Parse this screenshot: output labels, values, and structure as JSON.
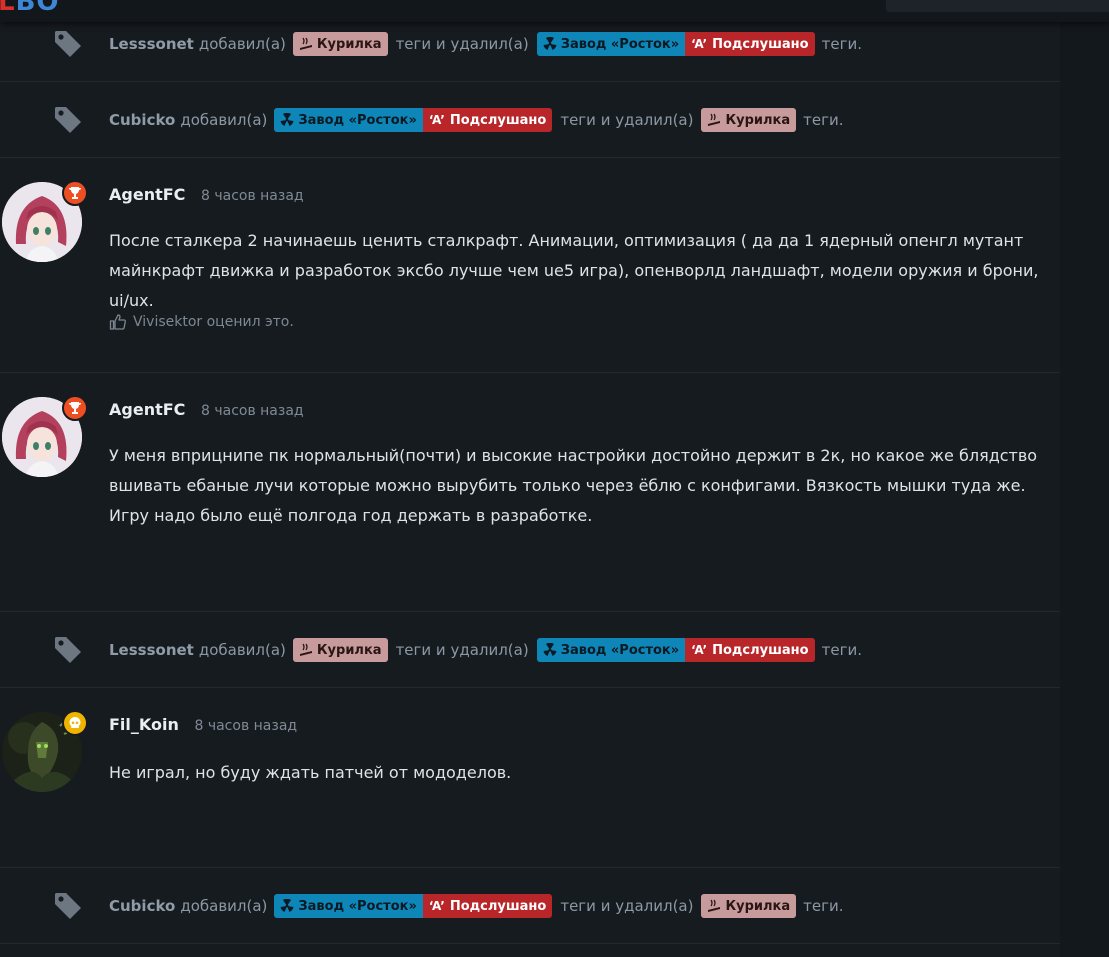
{
  "header": {
    "logo_part1": "L",
    "logo_part2": "BO"
  },
  "tags": {
    "smoke": "Курилка",
    "plant": "Завод «Росток»",
    "heard_mark": "‘A’",
    "heard": "Подслушано"
  },
  "events": [
    {
      "user": "Lesssonet",
      "added": "добавил(а)",
      "middle": "теги и удалил(а)",
      "tail": "теги."
    },
    {
      "user": "Cubicko",
      "added": "добавил(а)",
      "middle": "теги и удалил(а)",
      "tail": "теги."
    },
    {
      "user": "Lesssonet",
      "added": "добавил(а)",
      "middle": "теги и удалил(а)",
      "tail": "теги."
    },
    {
      "user": "Cubicko",
      "added": "добавил(а)",
      "middle": "теги и удалил(а)",
      "tail": "теги."
    }
  ],
  "posts": [
    {
      "author": "AgentFC",
      "time": "8 часов назад",
      "text": "После сталкера 2 начинаешь ценить сталкрафт. Анимации, оптимизация ( да да 1 ядерный опенгл мутант майнкрафт движка и разработок эксбо лучше чем ue5 игра), опенворлд ландшафт, модели оружия и брони, ui/ux.",
      "likes": "Vivisektor оценил это.",
      "badge_icon": "trophy-icon"
    },
    {
      "author": "AgentFC",
      "time": "8 часов назад",
      "text": "У меня вприцнипе пк нормальный(почти) и высокие настройки достойно держит в 2к, но какое же блядство вшивать ебаные лучи которые можно вырубить только через ёблю с конфигами. Вязкость мышки туда же. Игру надо было ещё полгода год держать в разработке.",
      "badge_icon": "trophy-icon"
    },
    {
      "author": "Fil_Koin",
      "time": "8 часов назад",
      "text": "Не играл, но буду ждать патчей от мододелов.",
      "badge_icon": "skull-icon"
    }
  ],
  "colors": {
    "background": "#161b20",
    "tag_smoke": "#c79b9b",
    "tag_plant": "#0f86b8",
    "tag_heard": "#b9262a",
    "badge_trophy": "#ee4f22",
    "badge_skull": "#f0b400"
  }
}
